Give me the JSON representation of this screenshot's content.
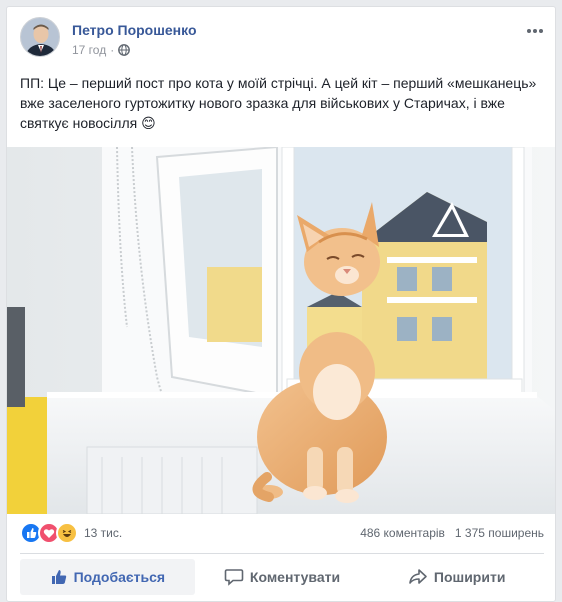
{
  "post": {
    "author": "Петро Порошенко",
    "time": "17 год",
    "separator": "·",
    "text": "ПП: Це – перший пост про кота у моїй стрічці. А цей кіт – перший «мешканець» вже заселеного гуртожитку нового зразка для військових у Старичах, і вже святкує новосілля 😊",
    "icons": {
      "more": "more-options-icon",
      "privacy": "globe-icon"
    }
  },
  "engagement": {
    "reaction_count": "13 тис.",
    "comments": "486 коментарів",
    "shares": "1 375 поширень",
    "reaction_icons": [
      "like-reaction-icon",
      "love-reaction-icon",
      "haha-reaction-icon"
    ]
  },
  "actions": {
    "like": "Подобається",
    "comment": "Коментувати",
    "share": "Поширити"
  },
  "colors": {
    "brand_link": "#385898",
    "like_active": "#4267b2",
    "love": "#f0506e",
    "haha": "#f7c042"
  }
}
